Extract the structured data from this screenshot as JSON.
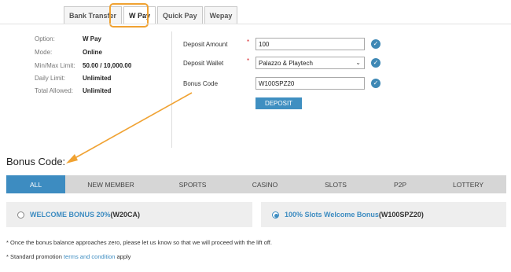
{
  "tabs": [
    {
      "label": "Bank Transfer",
      "active": false
    },
    {
      "label": "W Pay",
      "active": true
    },
    {
      "label": "Quick Pay",
      "active": false
    },
    {
      "label": "Wepay",
      "active": false
    }
  ],
  "info": {
    "option_label": "Option:",
    "option_value": "W Pay",
    "mode_label": "Mode:",
    "mode_value": "Online",
    "minmax_label": "Min/Max Limit:",
    "minmax_value": "50.00 / 10,000.00",
    "daily_label": "Daily Limit:",
    "daily_value": "Unlimited",
    "total_label": "Total Allowed:",
    "total_value": "Unlimited"
  },
  "form": {
    "amount_label": "Deposit Amount",
    "amount_value": "100",
    "wallet_label": "Deposit Wallet",
    "wallet_value": "Palazzo & Playtech",
    "bonus_label": "Bonus Code",
    "bonus_value": "W100SPZ20",
    "required_mark": "*",
    "deposit_button": "DEPOSIT"
  },
  "bonus_section": {
    "title": "Bonus Code:",
    "filters": [
      "ALL",
      "NEW MEMBER",
      "SPORTS",
      "CASINO",
      "SLOTS",
      "P2P",
      "LOTTERY"
    ],
    "active_filter": "ALL",
    "options": [
      {
        "name": "WELCOME BONUS 20%",
        "code": "(W20CA)",
        "selected": false
      },
      {
        "name": "100% Slots Welcome Bonus",
        "code": "(W100SPZ20)",
        "selected": true
      }
    ]
  },
  "notes": {
    "note1": "* Once the bonus balance approaches zero, please let us know so that we will proceed with the lift off.",
    "note2_prefix": "* Standard promotion ",
    "note2_link": "terms and condition",
    "note2_suffix": " apply"
  },
  "colors": {
    "accent": "#3d8cc1",
    "highlight": "#f0a232",
    "required": "#d9262b"
  }
}
